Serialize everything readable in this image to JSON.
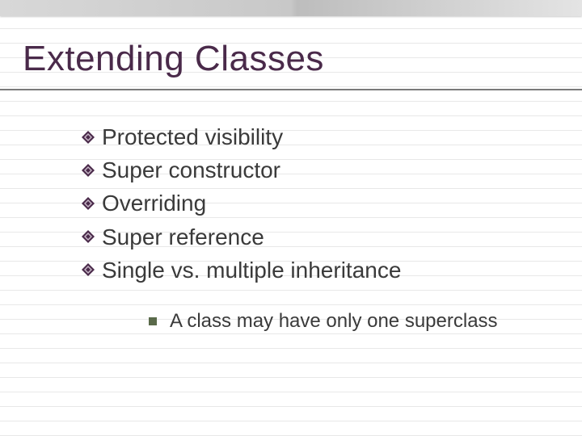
{
  "title": "Extending Classes",
  "bullets": [
    {
      "label": "Protected visibility"
    },
    {
      "label": "Super constructor"
    },
    {
      "label": "Overriding"
    },
    {
      "label": "Super reference"
    },
    {
      "label": "Single vs. multiple inheritance"
    }
  ],
  "subbullets": [
    {
      "label": "A class may have only one superclass"
    }
  ]
}
